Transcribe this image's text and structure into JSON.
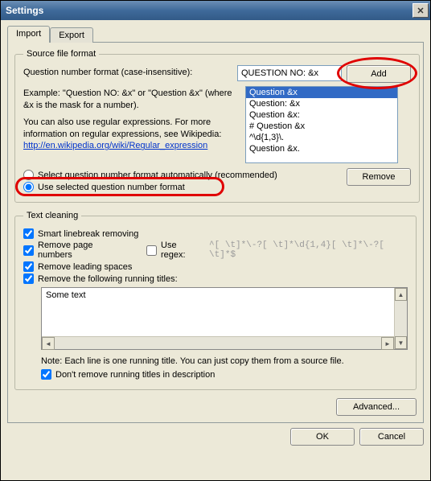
{
  "window": {
    "title": "Settings",
    "close": "✕"
  },
  "tabs": {
    "import": "Import",
    "export": "Export"
  },
  "source": {
    "legend": "Source file format",
    "fmt_label": "Question number format (case-insensitive):",
    "fmt_value": "QUESTION NO: &x",
    "add": "Add",
    "example": "Example: \"Question NO: &x\" or \"Question &x\" (where &x is the mask for a number).",
    "regex_note": "You can also use regular expressions. For more information on regular expressions, see Wikipedia:",
    "link": "http://en.wikipedia.org/wiki/Regular_expression",
    "items": [
      "Question &x",
      "Question: &x",
      "Question &x:",
      "# Question &x",
      "^\\d{1,3}\\.",
      "Question &x."
    ],
    "radio_auto": "Select question number format automatically (recommended)",
    "radio_use": "Use selected question number format",
    "remove": "Remove"
  },
  "clean": {
    "legend": "Text cleaning",
    "smart": "Smart linebreak removing",
    "pagenum": "Remove page numbers",
    "useregex": "Use regex:",
    "regex_sample": "^[ \\t]*\\-?[ \\t]*\\d{1,4}[ \\t]*\\-?[ \\t]*$",
    "leading": "Remove leading spaces",
    "titles": "Remove the following running titles:",
    "textarea": "Some text",
    "note": "Note: Each line is one running title. You can just copy them from a source file.",
    "dontremove": "Don't remove running titles in description"
  },
  "buttons": {
    "advanced": "Advanced...",
    "ok": "OK",
    "cancel": "Cancel"
  }
}
